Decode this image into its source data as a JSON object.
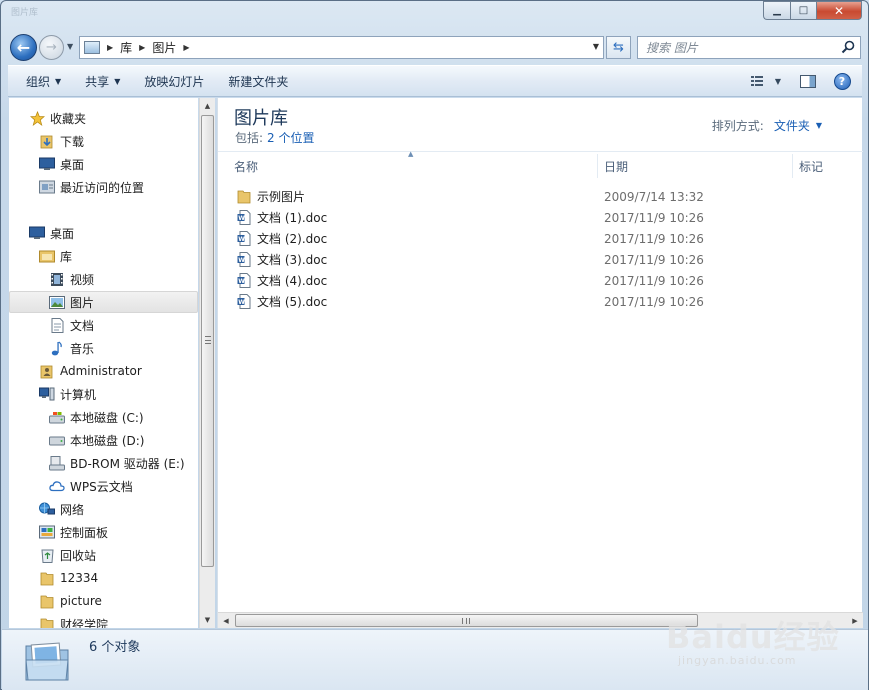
{
  "window": {
    "title": "图片库"
  },
  "address": {
    "crumbs": [
      "库",
      "图片"
    ]
  },
  "search": {
    "placeholder": "搜索 图片"
  },
  "toolbar": {
    "organize": "组织",
    "share": "共享",
    "slideshow": "放映幻灯片",
    "new_folder": "新建文件夹"
  },
  "nav": {
    "favorites": "收藏夹",
    "downloads": "下载",
    "desktop_fav": "桌面",
    "recent": "最近访问的位置",
    "desktop": "桌面",
    "libraries": "库",
    "videos": "视频",
    "pictures": "图片",
    "documents": "文档",
    "music": "音乐",
    "administrator": "Administrator",
    "computer": "计算机",
    "drive_c": "本地磁盘 (C:)",
    "drive_d": "本地磁盘 (D:)",
    "drive_e": "BD-ROM 驱动器 (E:)",
    "wps_cloud": "WPS云文档",
    "network": "网络",
    "control_panel": "控制面板",
    "recycle_bin": "回收站",
    "folder_12334": "12334",
    "folder_picture": "picture",
    "folder_finance": "财经学院"
  },
  "library": {
    "title": "图片库",
    "includes_label": "包括:",
    "includes_link": "2 个位置",
    "arrange_label": "排列方式:",
    "arrange_value": "文件夹"
  },
  "columns": {
    "name": "名称",
    "date": "日期",
    "tags": "标记"
  },
  "files": [
    {
      "name": "示例图片",
      "date": "2009/7/14 13:32",
      "type": "folder"
    },
    {
      "name": "文档 (1).doc",
      "date": "2017/11/9 10:26",
      "type": "doc"
    },
    {
      "name": "文档 (2).doc",
      "date": "2017/11/9 10:26",
      "type": "doc"
    },
    {
      "name": "文档 (3).doc",
      "date": "2017/11/9 10:26",
      "type": "doc"
    },
    {
      "name": "文档 (4).doc",
      "date": "2017/11/9 10:26",
      "type": "doc"
    },
    {
      "name": "文档 (5).doc",
      "date": "2017/11/9 10:26",
      "type": "doc"
    }
  ],
  "details": {
    "count": "6 个对象"
  },
  "watermark": {
    "brand": "Baidu经验",
    "url": "jingyan.baidu.com"
  }
}
